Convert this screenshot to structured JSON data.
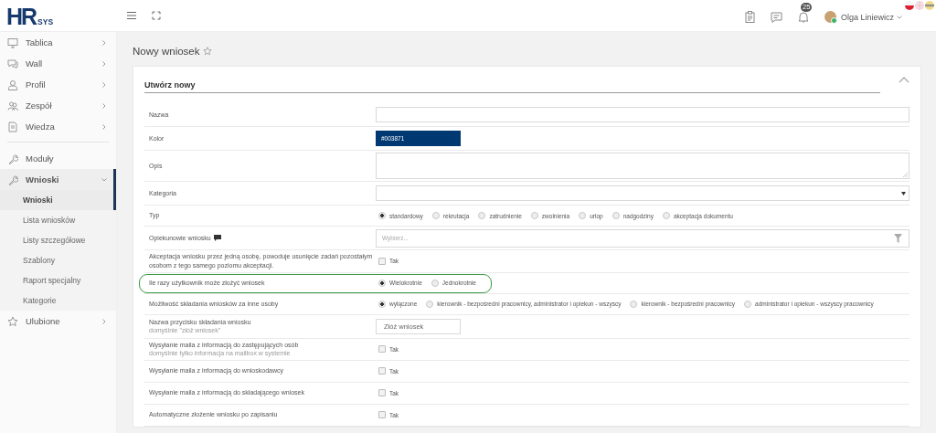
{
  "logo": {
    "main": "HR",
    "sub": "SYS"
  },
  "header": {
    "notifications": "25",
    "user": "Olga Liniewicz"
  },
  "languages": [
    {
      "kind": "pl",
      "selected": true
    },
    {
      "kind": "gb",
      "selected": false
    },
    {
      "kind": "de",
      "selected": false
    }
  ],
  "sidebar": {
    "sections": [
      {
        "items": [
          {
            "label": "Tablica",
            "expandable": true,
            "expanded": false
          },
          {
            "label": "Wall",
            "expandable": true,
            "expanded": false
          },
          {
            "label": "Profil",
            "expandable": true,
            "expanded": false
          },
          {
            "label": "Zespół",
            "expandable": true,
            "expanded": false
          },
          {
            "label": "Wiedza",
            "expandable": true,
            "expanded": false
          }
        ]
      },
      {
        "items": [
          {
            "label": "Moduły",
            "expandable": false,
            "expanded": false
          },
          {
            "label": "Wnioski",
            "expandable": true,
            "expanded": true,
            "children": [
              {
                "label": "Wnioski",
                "selected": true
              },
              {
                "label": "Lista wniosków",
                "selected": false
              },
              {
                "label": "Listy szczegółowe",
                "selected": false
              },
              {
                "label": "Szablony",
                "selected": false
              },
              {
                "label": "Raport specjalny",
                "selected": false
              },
              {
                "label": "Kategorie",
                "selected": false
              }
            ]
          },
          {
            "label": "Ulubione",
            "expandable": true,
            "expanded": false
          }
        ]
      }
    ]
  },
  "page_title": "Nowy wniosek",
  "card": {
    "title": "Utwórz nowy",
    "expanded": true
  },
  "form": [
    {
      "label": "Nazwa",
      "kind": "text",
      "highlighted": false
    },
    {
      "label": "Kolor",
      "kind": "color",
      "value": "#003871",
      "color": "#003871",
      "highlighted": false
    },
    {
      "label": "Opis",
      "kind": "textarea",
      "highlighted": false
    },
    {
      "label": "Kategoria",
      "kind": "select",
      "highlighted": false
    },
    {
      "label": "Typ",
      "kind": "radio",
      "highlighted": false,
      "options": [
        {
          "label": "standardowy",
          "selected": true
        },
        {
          "label": "rekrutacja",
          "selected": false
        },
        {
          "label": "zatrudnienie",
          "selected": false
        },
        {
          "label": "zwolnienia",
          "selected": false
        },
        {
          "label": "urlop",
          "selected": false
        },
        {
          "label": "nadgodziny",
          "selected": false
        },
        {
          "label": "akceptacja dokumentu",
          "selected": false
        }
      ]
    },
    {
      "label": "Opiekunowie wniosku",
      "kind": "multiselect",
      "note_icon": true,
      "placeholder": "Wybierz...",
      "highlighted": false
    },
    {
      "label": "Akceptacja wniosku przez jedną osobę, powoduje usunięcie zadań pozostałym osobom z tego samego poziomu akceptacji.",
      "kind": "checkbox",
      "option": "Tak",
      "checked": false,
      "highlighted": false
    },
    {
      "label": "Ile razy użytkownik może złożyć wniosek",
      "kind": "radio",
      "highlighted": true,
      "options": [
        {
          "label": "Wielokrotnie",
          "selected": true
        },
        {
          "label": "Jednokrotnie",
          "selected": false
        }
      ]
    },
    {
      "label": "Możliwość składania wniosków za inne osoby",
      "kind": "radio",
      "highlighted": false,
      "options": [
        {
          "label": "wyłączone",
          "selected": true
        },
        {
          "label": "kierownik - bezpośredni pracownicy, administrator i opiekun - wszyscy",
          "selected": false
        },
        {
          "label": "kierownik - bezpośredni pracownicy",
          "selected": false
        },
        {
          "label": "administrator i opiekun - wszyscy pracownicy",
          "selected": false
        }
      ]
    },
    {
      "label": "Nazwa przycisku składania wniosku",
      "hint": "domyślnie \"złóż wniosek\"",
      "kind": "short-text",
      "value": "Złóż wniosek",
      "highlighted": false
    },
    {
      "label": "Wysyłanie maila z informacją do zastępujących osób",
      "hint": "domyślnie tylko informacja na mailbox w systemie",
      "kind": "checkbox",
      "option": "Tak",
      "checked": false,
      "highlighted": false
    },
    {
      "label": "Wysyłanie maila z informacją do wnioskodawcy",
      "kind": "checkbox",
      "option": "Tak",
      "checked": false,
      "highlighted": false
    },
    {
      "label": "Wysyłanie maila z informacją do składającego wniosek",
      "kind": "checkbox",
      "option": "Tak",
      "checked": false,
      "highlighted": false
    },
    {
      "label": "Automatyczne złożenie wniosku po zapisaniu",
      "kind": "checkbox",
      "option": "Tak",
      "checked": false,
      "highlighted": false
    }
  ]
}
